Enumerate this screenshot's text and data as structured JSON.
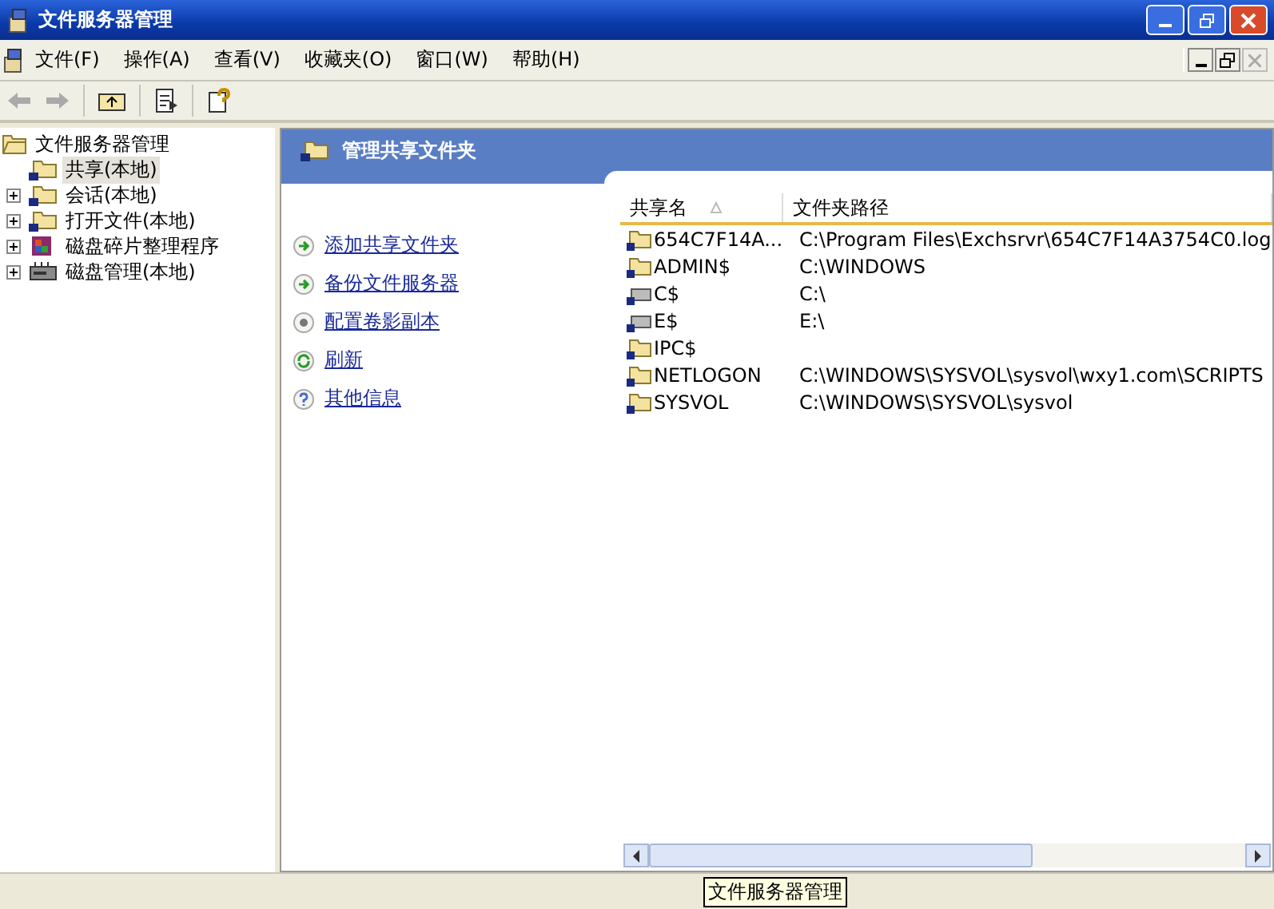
{
  "window": {
    "title": "文件服务器管理"
  },
  "menu": [
    "文件(F)",
    "操作(A)",
    "查看(V)",
    "收藏夹(O)",
    "窗口(W)",
    "帮助(H)"
  ],
  "tree": [
    {
      "label": "文件服务器管理",
      "expanded": true,
      "selected": false,
      "children": [
        {
          "label": "共享(本地)",
          "selected": true,
          "kind": "share"
        },
        {
          "label": "会话(本地)",
          "selected": false,
          "expanded": false,
          "kind": "share"
        },
        {
          "label": "打开文件(本地)",
          "selected": false,
          "expanded": false,
          "kind": "share"
        },
        {
          "label": "磁盘碎片整理程序",
          "selected": false,
          "expanded": false,
          "kind": "defrag"
        },
        {
          "label": "磁盘管理(本地)",
          "selected": false,
          "expanded": false,
          "kind": "disk"
        }
      ]
    }
  ],
  "panel": {
    "title": "管理共享文件夹"
  },
  "tasks": [
    {
      "label": "添加共享文件夹",
      "kind": "go"
    },
    {
      "label": "备份文件服务器",
      "kind": "go"
    },
    {
      "label": "配置卷影副本",
      "kind": "gear"
    },
    {
      "label": "刷新",
      "kind": "refresh"
    },
    {
      "label": "其他信息",
      "kind": "help"
    }
  ],
  "table": {
    "columns": [
      "共享名",
      "文件夹路径"
    ],
    "rows": [
      {
        "name": "654C7F14A...",
        "path": "C:\\Program Files\\Exchsrvr\\654C7F14A3754C0.log",
        "kind": "folder"
      },
      {
        "name": "ADMIN$",
        "path": "C:\\WINDOWS",
        "kind": "folder"
      },
      {
        "name": "C$",
        "path": "C:\\",
        "kind": "drive"
      },
      {
        "name": "E$",
        "path": "E:\\",
        "kind": "drive"
      },
      {
        "name": "IPC$",
        "kind": "folder"
      },
      {
        "name": "NETLOGON",
        "path": "C:\\WINDOWS\\SYSVOL\\sysvol\\wxy1.com\\SCRIPTS",
        "kind": "folder"
      },
      {
        "name": "SYSVOL",
        "path": "C:\\WINDOWS\\SYSVOL\\sysvol",
        "kind": "folder"
      }
    ]
  },
  "tooltip": "文件服务器管理"
}
